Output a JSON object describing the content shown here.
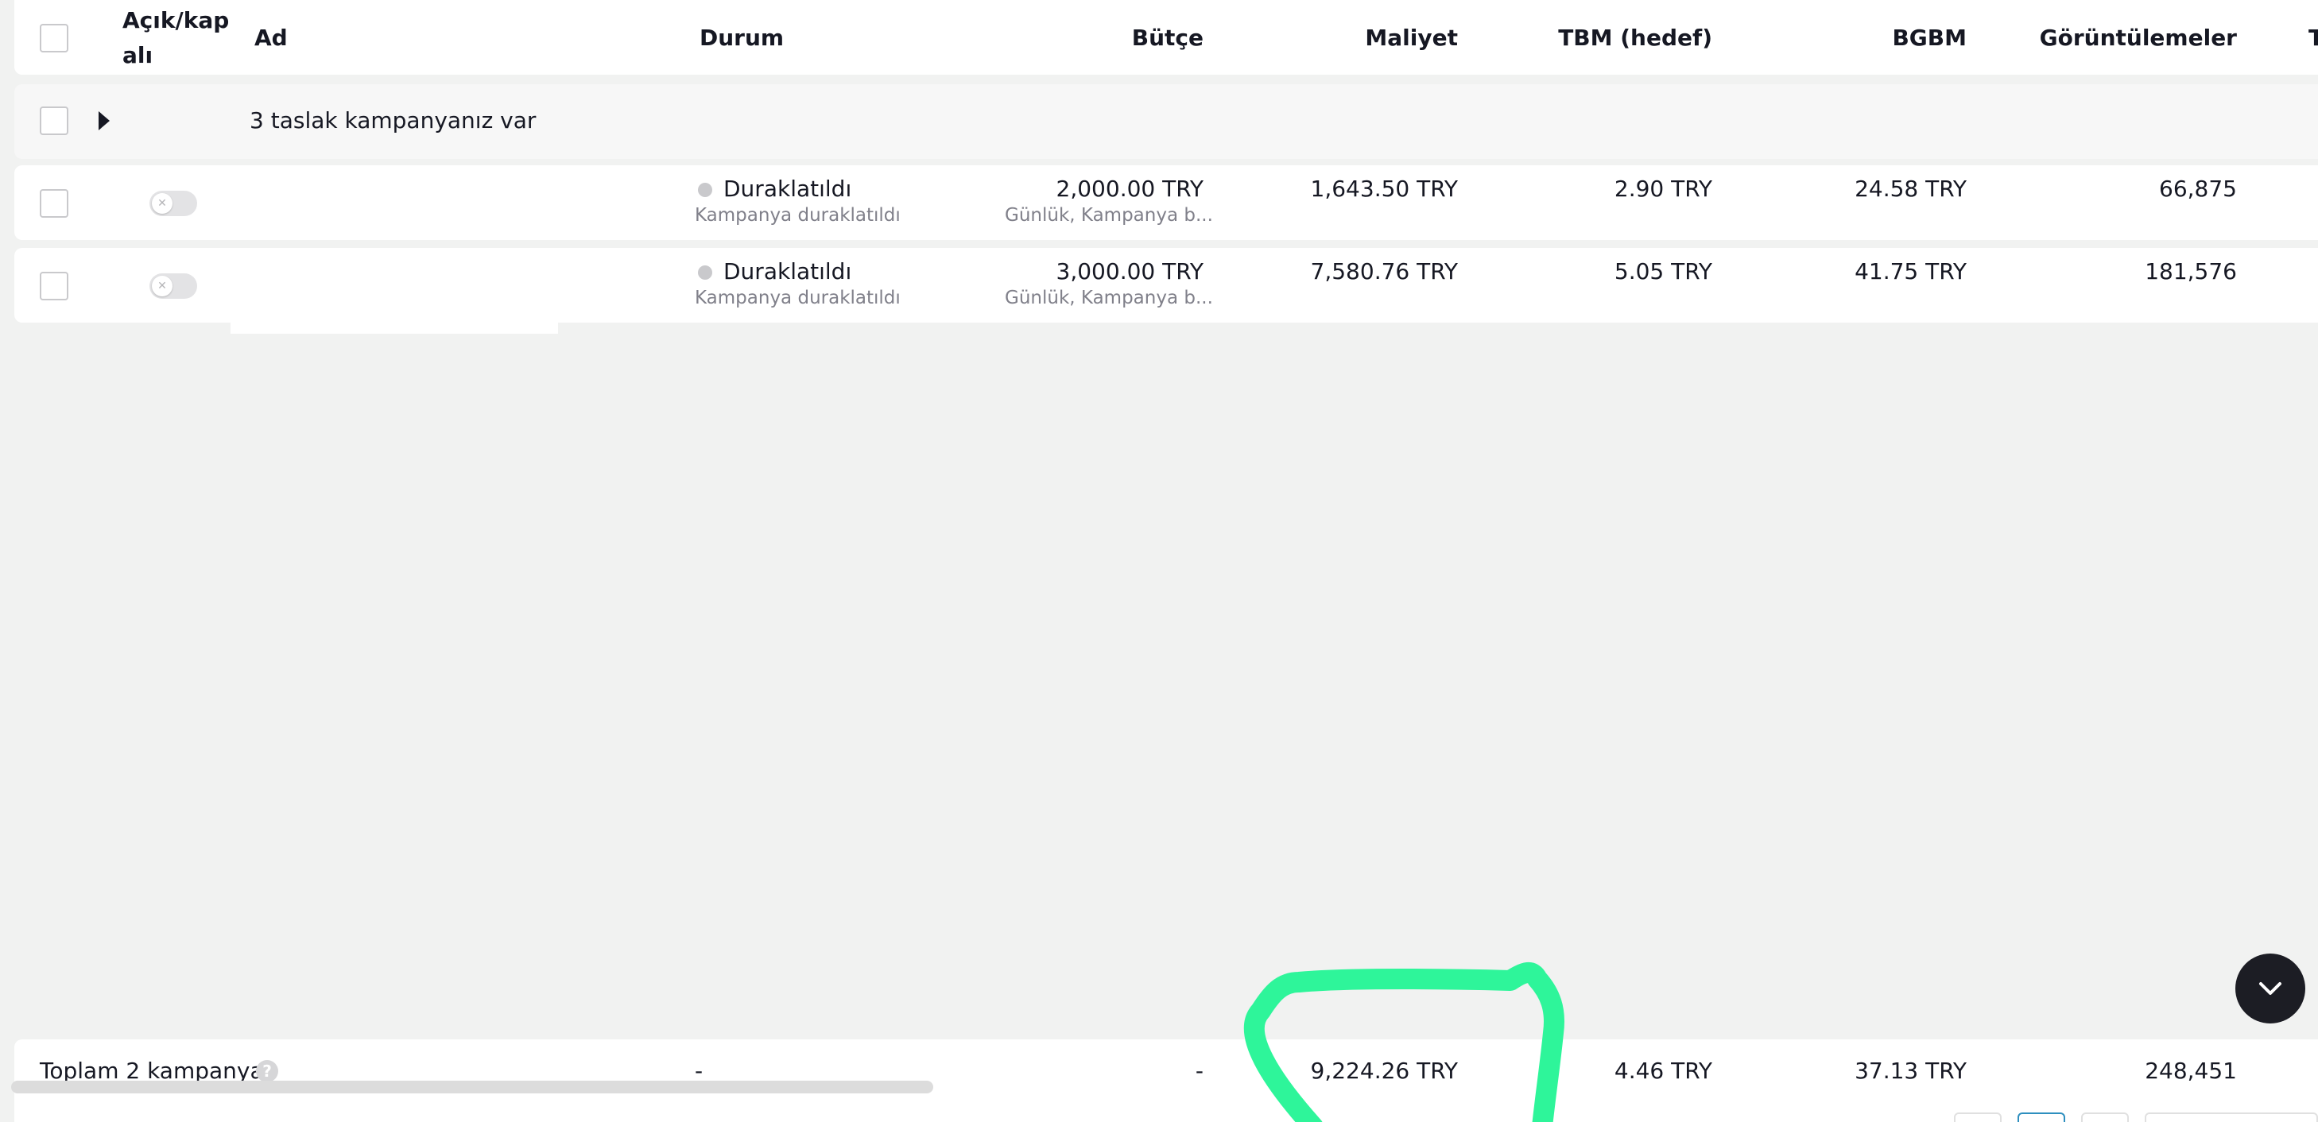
{
  "header": {
    "col_onoff": "Açık/kapalı",
    "col_onoff_line1": "Açık/kap",
    "col_onoff_line2": "alı",
    "col_name": "Ad",
    "col_status": "Durum",
    "col_budget": "Bütçe",
    "col_cost": "Maliyet",
    "col_cpm": "TBM (hedef)",
    "col_cpv": "BGBM",
    "col_impressions": "Görüntülemeler",
    "col_next_partial": "T"
  },
  "drafts": {
    "label": "3 taslak kampanyanız var"
  },
  "rows": [
    {
      "status": "Duraklatıldı",
      "status_sub": "Kampanya duraklatıldı",
      "budget": "2,000.00 TRY",
      "budget_sub": "Günlük, Kampanya b...",
      "cost": "1,643.50 TRY",
      "cpm": "2.90 TRY",
      "cpv": "24.58 TRY",
      "impressions": "66,875"
    },
    {
      "status": "Duraklatıldı",
      "status_sub": "Kampanya duraklatıldı",
      "budget": "3,000.00 TRY",
      "budget_sub": "Günlük, Kampanya b...",
      "cost": "7,580.76 TRY",
      "cpm": "5.05 TRY",
      "cpv": "41.75 TRY",
      "impressions": "181,576"
    }
  ],
  "footer": {
    "label": "Toplam 2 kampanya",
    "help_glyph": "?",
    "status": "-",
    "budget": "-",
    "cost": "9,224.26 TRY",
    "cpm": "4.46 TRY",
    "cpv": "37.13 TRY",
    "impressions": "248,451"
  },
  "colors": {
    "annotation": "#2ef59a",
    "status_dot": "#c9c9cc",
    "fab_bg": "#1c1d24"
  }
}
